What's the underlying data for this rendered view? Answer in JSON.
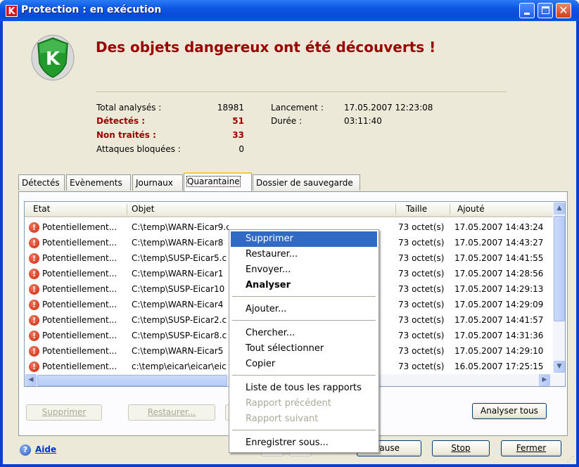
{
  "window": {
    "title": "Protection : en exécution",
    "logo_letter": "K",
    "close_glyph": "✕"
  },
  "header": {
    "headline": "Des objets dangereux ont été découverts !",
    "shield_letter": "K"
  },
  "stats": {
    "total_label": "Total analysés :",
    "total_value": "18981",
    "detected_label": "Détectés :",
    "detected_value": "51",
    "untreated_label": "Non traités :",
    "untreated_value": "33",
    "blocked_label": "Attaques bloquées :",
    "blocked_value": "0",
    "launch_label": "Lancement :",
    "launch_value": "17.05.2007 12:23:08",
    "duration_label": "Durée :",
    "duration_value": "03:11:40"
  },
  "tabs": [
    "Détectés",
    "Evènements",
    "Journaux",
    "Quarantaine",
    "Dossier de sauvegarde"
  ],
  "active_tab": "Quarantaine",
  "list": {
    "columns": [
      "Etat",
      "Objet",
      "Taille",
      "Ajouté"
    ],
    "rows": [
      {
        "state": "Potentiellement...",
        "object": "C:\\temp\\WARN-Eicar9.com",
        "size": "73 octet(s)",
        "added": "17.05.2007 14:43:24"
      },
      {
        "state": "Potentiellement...",
        "object": "C:\\temp\\WARN-Eicar8",
        "size": "73 octet(s)",
        "added": "17.05.2007 14:43:27"
      },
      {
        "state": "Potentiellement...",
        "object": "C:\\temp\\SUSP-Eicar5.c",
        "size": "73 octet(s)",
        "added": "17.05.2007 14:41:55"
      },
      {
        "state": "Potentiellement...",
        "object": "C:\\temp\\WARN-Eicar1",
        "size": "73 octet(s)",
        "added": "17.05.2007 14:28:56"
      },
      {
        "state": "Potentiellement...",
        "object": "C:\\temp\\SUSP-Eicar10",
        "size": "73 octet(s)",
        "added": "17.05.2007 14:29:13"
      },
      {
        "state": "Potentiellement...",
        "object": "C:\\temp\\WARN-Eicar4",
        "size": "73 octet(s)",
        "added": "17.05.2007 14:29:09"
      },
      {
        "state": "Potentiellement...",
        "object": "C:\\temp\\SUSP-Eicar2.c",
        "size": "73 octet(s)",
        "added": "17.05.2007 14:41:57"
      },
      {
        "state": "Potentiellement...",
        "object": "C:\\temp\\SUSP-Eicar8.c",
        "size": "73 octet(s)",
        "added": "17.05.2007 14:31:36"
      },
      {
        "state": "Potentiellement...",
        "object": "C:\\temp\\WARN-Eicar5",
        "size": "73 octet(s)",
        "added": "17.05.2007 14:29:10"
      },
      {
        "state": "Potentiellement...",
        "object": "c:\\temp\\eicar\\eicar\\eic",
        "size": "73 octet(s)",
        "added": "16.05.2007 17:25:15"
      }
    ],
    "warn_glyph": "!"
  },
  "buttons": {
    "delete": "Supprimer",
    "restore": "Restaurer...",
    "scan_all": "Analyser tous",
    "pause": "Pause",
    "stop": "Stop",
    "close": "Fermer",
    "help": "Aide"
  },
  "menu": {
    "delete": "Supprimer",
    "restore": "Restaurer...",
    "send": "Envoyer...",
    "scan": "Analyser",
    "add": "Ajouter...",
    "search": "Chercher...",
    "select_all": "Tout sélectionner",
    "copy": "Copier",
    "all_reports": "Liste de tous les rapports",
    "prev_report": "Rapport précédent",
    "next_report": "Rapport suivant",
    "save_as": "Enregistrer sous..."
  },
  "icons": {
    "help_glyph": "?",
    "scroll_up": "▲",
    "scroll_down": "▼",
    "scroll_left": "◀",
    "scroll_right": "▶"
  },
  "colors": {
    "danger": "#9a0000",
    "selection": "#316ac5",
    "xp_blue": "#0a4bd6"
  }
}
